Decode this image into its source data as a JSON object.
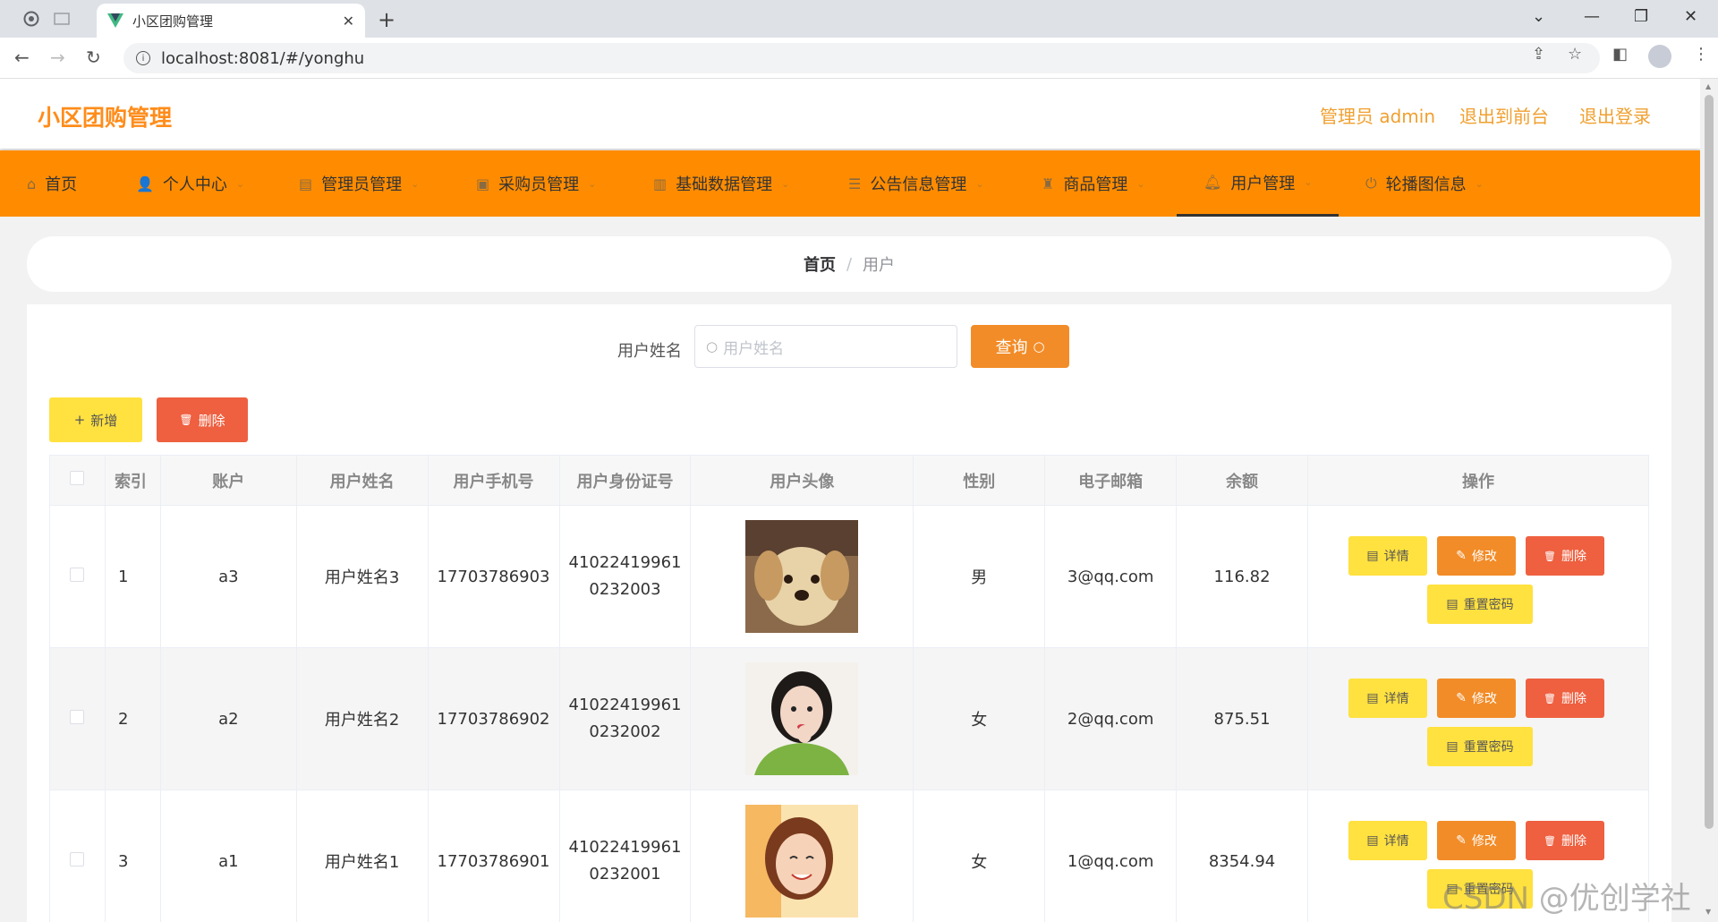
{
  "browser": {
    "tab_title": "小区团购管理",
    "url": "localhost:8081/#/yonghu"
  },
  "header": {
    "logo": "小区团购管理",
    "admin_label": "管理员 admin",
    "to_front": "退出到前台",
    "logout": "退出登录"
  },
  "nav": {
    "items": [
      {
        "label": "首页",
        "icon": "home-icon"
      },
      {
        "label": "个人中心",
        "icon": "user-icon"
      },
      {
        "label": "管理员管理",
        "icon": "clipboard-icon"
      },
      {
        "label": "采购员管理",
        "icon": "cart-icon"
      },
      {
        "label": "基础数据管理",
        "icon": "briefcase-icon"
      },
      {
        "label": "公告信息管理",
        "icon": "list-icon"
      },
      {
        "label": "商品管理",
        "icon": "trophy-icon"
      },
      {
        "label": "用户管理",
        "icon": "bell-icon"
      },
      {
        "label": "轮播图信息",
        "icon": "power-icon"
      }
    ],
    "active_index": 7
  },
  "breadcrumb": {
    "home": "首页",
    "current": "用户"
  },
  "search": {
    "label": "用户姓名",
    "placeholder": "用户姓名",
    "button": "查询"
  },
  "toolbar": {
    "add": "新增",
    "delete": "删除"
  },
  "table": {
    "headers": [
      "索引",
      "账户",
      "用户姓名",
      "用户手机号",
      "用户身份证号",
      "用户头像",
      "性别",
      "电子邮箱",
      "余额",
      "操作"
    ],
    "rows": [
      {
        "index": "1",
        "account": "a3",
        "name": "用户姓名3",
        "phone": "17703786903",
        "id_line1": "41022419961",
        "id_line2": "0232003",
        "avatar": "puppy",
        "gender": "男",
        "email": "3@qq.com",
        "balance": "116.82"
      },
      {
        "index": "2",
        "account": "a2",
        "name": "用户姓名2",
        "phone": "17703786902",
        "id_line1": "41022419961",
        "id_line2": "0232002",
        "avatar": "girl-green-sweater",
        "gender": "女",
        "email": "2@qq.com",
        "balance": "875.51"
      },
      {
        "index": "3",
        "account": "a1",
        "name": "用户姓名1",
        "phone": "17703786901",
        "id_line1": "41022419961",
        "id_line2": "0232001",
        "avatar": "girl-smiling",
        "gender": "女",
        "email": "1@qq.com",
        "balance": "8354.94"
      }
    ],
    "actions": {
      "detail": "详情",
      "edit": "修改",
      "delete": "删除",
      "reset": "重置密码"
    }
  },
  "watermark": "CSDN @优创学社",
  "colors": {
    "brand": "#ff8c00",
    "accent": "#f28c28",
    "warn": "#ffe140",
    "danger": "#ee6040"
  }
}
